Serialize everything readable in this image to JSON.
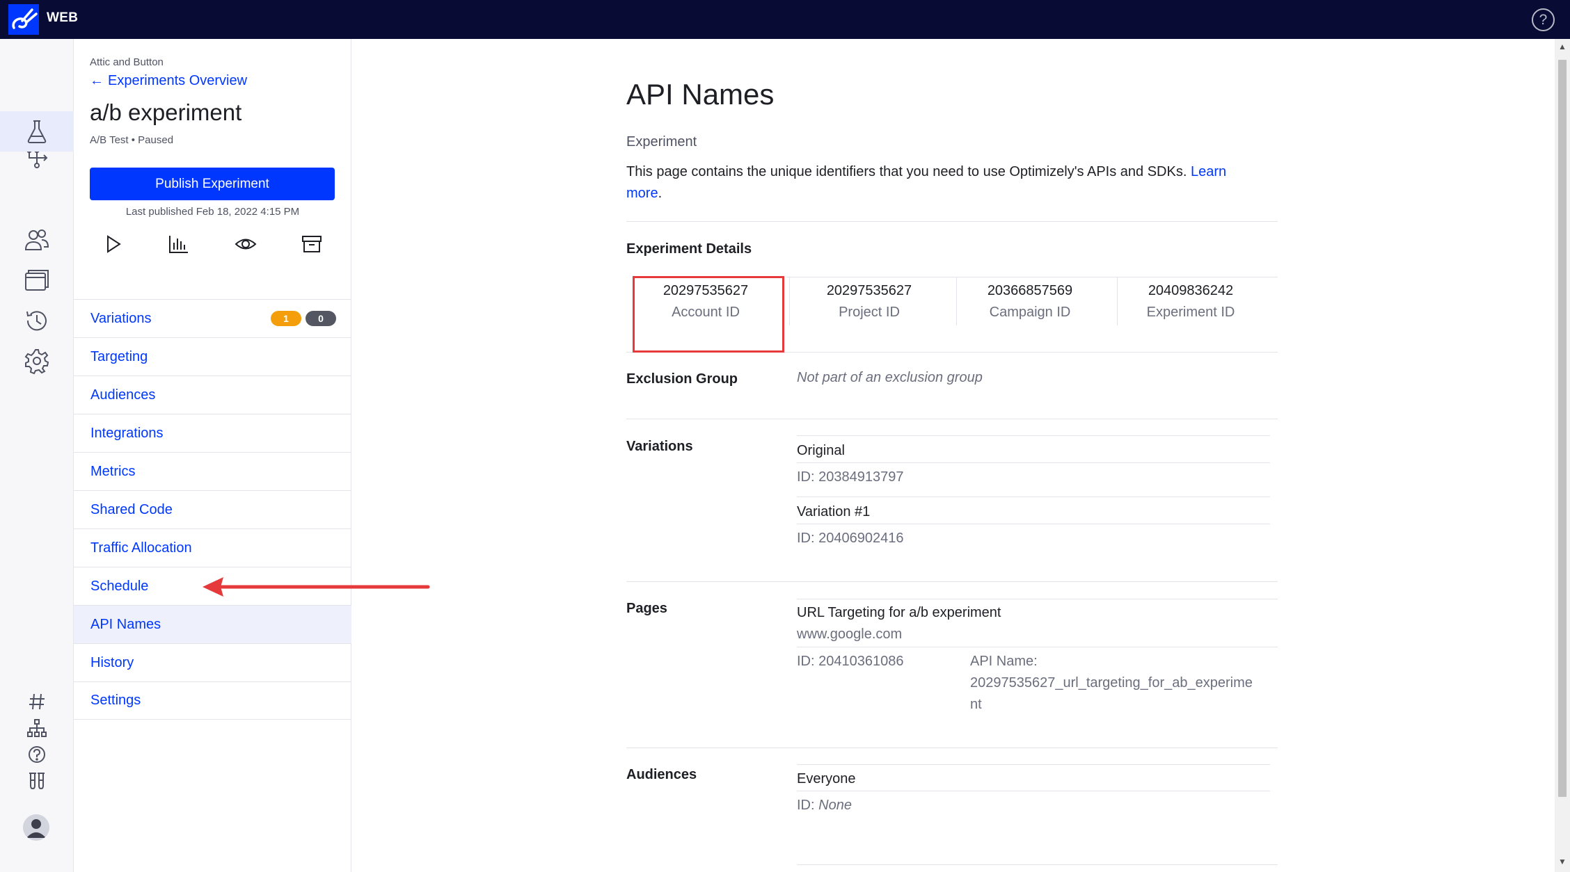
{
  "topbar": {
    "product": "WEB",
    "help_glyph": "?"
  },
  "rail": {
    "items": [
      "flows-icon",
      "experiments-flask-icon",
      "audiences-icon",
      "pages-icon",
      "history-icon",
      "settings-gear-icon"
    ],
    "bottom": [
      "hash-icon",
      "sitemap-icon",
      "help-circle-icon",
      "labs-icon"
    ]
  },
  "sidebar": {
    "project": "Attic and Button",
    "back_label": "Experiments Overview",
    "back_arrow": "←",
    "experiment_name": "a/b experiment",
    "meta": "A/B Test • Paused",
    "publish_label": "Publish Experiment",
    "last_published": "Last published Feb 18, 2022 4:15 PM",
    "actions": [
      "play-icon",
      "results-chart-icon",
      "preview-eye-icon",
      "archive-icon"
    ],
    "nav": [
      {
        "label": "Variations",
        "badges": [
          "1",
          "0"
        ]
      },
      {
        "label": "Targeting"
      },
      {
        "label": "Audiences"
      },
      {
        "label": "Integrations"
      },
      {
        "label": "Metrics"
      },
      {
        "label": "Shared Code"
      },
      {
        "label": "Traffic Allocation"
      },
      {
        "label": "Schedule"
      },
      {
        "label": "API Names",
        "active": true
      },
      {
        "label": "History"
      },
      {
        "label": "Settings"
      }
    ]
  },
  "main": {
    "title": "API Names",
    "section": "Experiment",
    "intro_text": "This page contains the unique identifiers that you need to use Optimizely's APIs and SDKs. ",
    "intro_link": "Learn more",
    "intro_end": ".",
    "details_heading": "Experiment Details",
    "ids": [
      {
        "value": "20297535627",
        "label": "Account ID"
      },
      {
        "value": "20297535627",
        "label": "Project ID"
      },
      {
        "value": "20366857569",
        "label": "Campaign ID"
      },
      {
        "value": "20409836242",
        "label": "Experiment ID"
      }
    ],
    "exclusion": {
      "heading": "Exclusion Group",
      "value": "Not part of an exclusion group"
    },
    "variations": {
      "heading": "Variations",
      "items": [
        {
          "name": "Original",
          "id": "ID: 20384913797"
        },
        {
          "name": "Variation #1",
          "id": "ID: 20406902416"
        }
      ]
    },
    "pages": {
      "heading": "Pages",
      "name": "URL Targeting for a/b experiment",
      "url": "www.google.com",
      "id": "ID: 20410361086",
      "api_label": "API Name:",
      "api_value_1": "20297535627_url_targeting_for_ab_experime",
      "api_value_2": "nt"
    },
    "audiences": {
      "heading": "Audiences",
      "name": "Everyone",
      "id_prefix": "ID: ",
      "id_value": "None"
    }
  },
  "colors": {
    "topbar": "#080c35",
    "accent": "#0037ff",
    "badge_orange": "#f59e0b",
    "badge_gray": "#545661",
    "annotation_red": "#e5393b"
  }
}
